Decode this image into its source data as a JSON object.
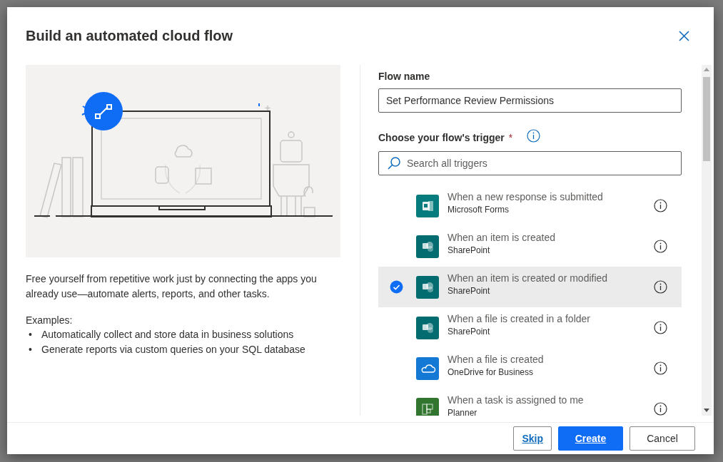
{
  "dialog": {
    "title": "Build an automated cloud flow"
  },
  "intro": {
    "description": "Free yourself from repetitive work just by connecting the apps you already use—automate alerts, reports, and other tasks.",
    "examples_label": "Examples:",
    "examples": [
      {
        "bullet": "•",
        "text": "Automatically collect and store data in business solutions"
      },
      {
        "bullet": "•",
        "text": "Generate reports via custom queries on your SQL database"
      }
    ]
  },
  "flow_name": {
    "label": "Flow name",
    "value": "Set Performance Review Permissions"
  },
  "trigger": {
    "label": "Choose your flow's trigger",
    "required_mark": "*",
    "search_placeholder": "Search all triggers"
  },
  "triggers": [
    {
      "title": "When a new response is submitted",
      "connector": "Microsoft Forms",
      "kind": "forms",
      "selected": false
    },
    {
      "title": "When an item is created",
      "connector": "SharePoint",
      "kind": "sharepoint",
      "selected": false
    },
    {
      "title": "When an item is created or modified",
      "connector": "SharePoint",
      "kind": "sharepoint",
      "selected": true
    },
    {
      "title": "When a file is created in a folder",
      "connector": "SharePoint",
      "kind": "sharepoint",
      "selected": false
    },
    {
      "title": "When a file is created",
      "connector": "OneDrive for Business",
      "kind": "onedrive",
      "selected": false
    },
    {
      "title": "When a task is assigned to me",
      "connector": "Planner",
      "kind": "planner",
      "selected": false
    }
  ],
  "buttons": [
    {
      "label": "Skip",
      "kind": "link"
    },
    {
      "label": "Create",
      "kind": "primary"
    },
    {
      "label": "Cancel",
      "kind": "default"
    }
  ]
}
